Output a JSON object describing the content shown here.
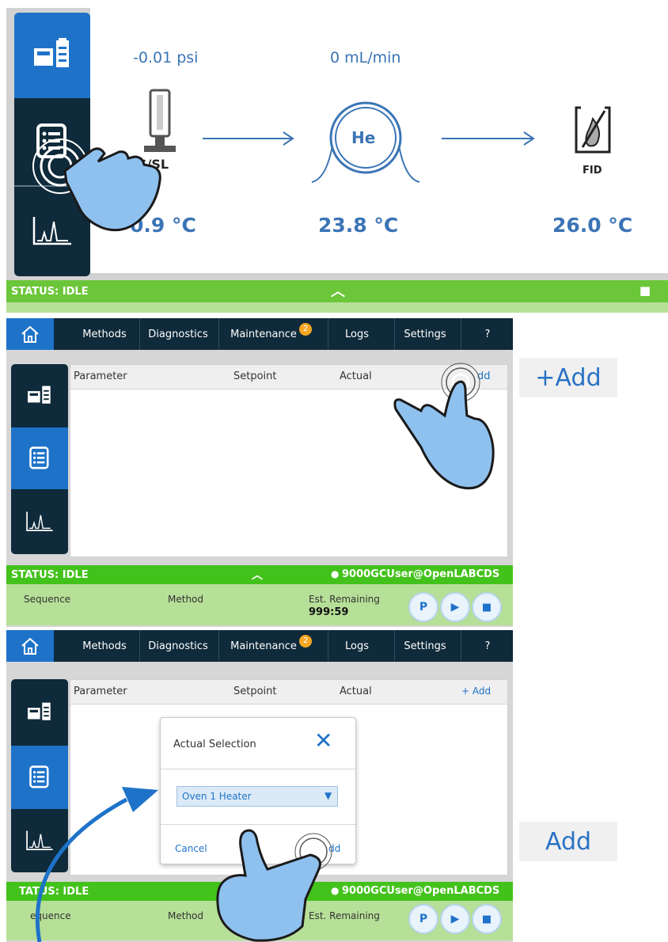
{
  "panel1": {
    "pressure": "-0.01 psi",
    "flow": "0 mL/min",
    "inlet_label": "S/SL",
    "column_gas": "He",
    "detector_label": "FID",
    "temps": [
      "0.9 °C",
      "23.8 °C",
      "26.0 °C"
    ],
    "status": "STATUS: IDLE"
  },
  "nav": {
    "items": [
      "Methods",
      "Diagnostics",
      "Maintenance",
      "Logs",
      "Settings",
      "?"
    ],
    "maintenance_badge": "2"
  },
  "table": {
    "headers": [
      "Parameter",
      "Setpoint",
      "Actual"
    ],
    "add_label": "+ Add",
    "add_partial": "dd"
  },
  "status2": {
    "status": "STATUS: IDLE",
    "user": "9000GCUser@OpenLABCDS",
    "sequence": "Sequence",
    "method": "Method",
    "est_remaining": "Est. Remaining",
    "remaining_value": "999:59"
  },
  "dialog": {
    "title": "Actual Selection",
    "selected": "Oven 1 Heater",
    "cancel": "Cancel",
    "add_partial": "dd"
  },
  "status3": {
    "status_partial": "TATUS: IDLE",
    "user": "9000GCUser@OpenLABCDS",
    "sequence_partial": "equence",
    "method": "Method",
    "est_remaining": "Est. Remaining"
  },
  "callouts": {
    "add_plus": "+Add",
    "add": "Add"
  },
  "colors": {
    "dark": "#0f2a3a",
    "accent_blue": "#1e73c9",
    "status_green": "#6cc63a",
    "light_green": "#b6df97",
    "badge_orange": "#f5a623"
  }
}
